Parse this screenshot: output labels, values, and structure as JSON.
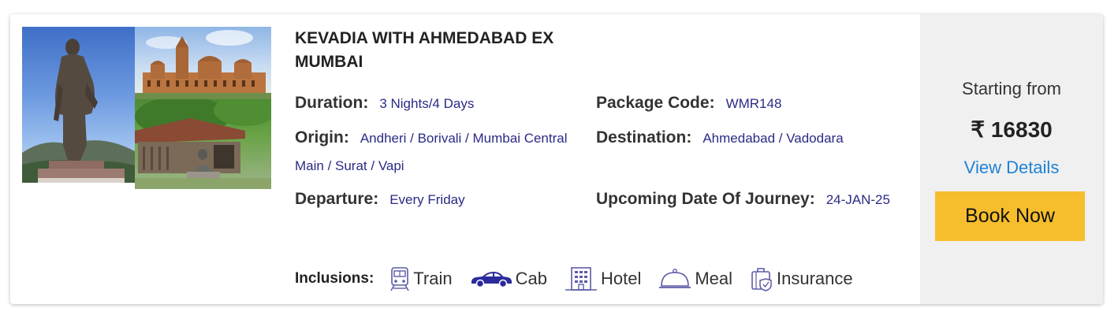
{
  "package": {
    "title": "KEVADIA WITH AHMEDABAD EX MUMBAI",
    "duration_label": "Duration:",
    "duration": "3 Nights/4 Days",
    "code_label": "Package Code:",
    "code": "WMR148",
    "origin_label": "Origin:",
    "origin": "Andheri / Borivali / Mumbai Central Main / Surat / Vapi",
    "destination_label": "Destination:",
    "destination": "Ahmedabad / Vadodara",
    "departure_label": "Departure:",
    "departure": "Every Friday",
    "journey_label": "Upcoming Date Of Journey:",
    "journey_date": "24-JAN-25"
  },
  "inclusions": {
    "label": "Inclusions:",
    "items": [
      {
        "label": "Train",
        "icon": "train-icon"
      },
      {
        "label": "Cab",
        "icon": "car-icon"
      },
      {
        "label": "Hotel",
        "icon": "hotel-icon"
      },
      {
        "label": "Meal",
        "icon": "meal-cloche-icon"
      },
      {
        "label": "Insurance",
        "icon": "insurance-icon"
      }
    ]
  },
  "pricing": {
    "starting_label": "Starting from",
    "price": "₹ 16830",
    "view_details": "View Details",
    "book_now": "Book Now"
  },
  "colors": {
    "value_text": "#2a2a86",
    "link": "#1f82d6",
    "book_button": "#f6be2c",
    "side_panel": "#f0f0f0",
    "icon": "#5b5ba5"
  }
}
